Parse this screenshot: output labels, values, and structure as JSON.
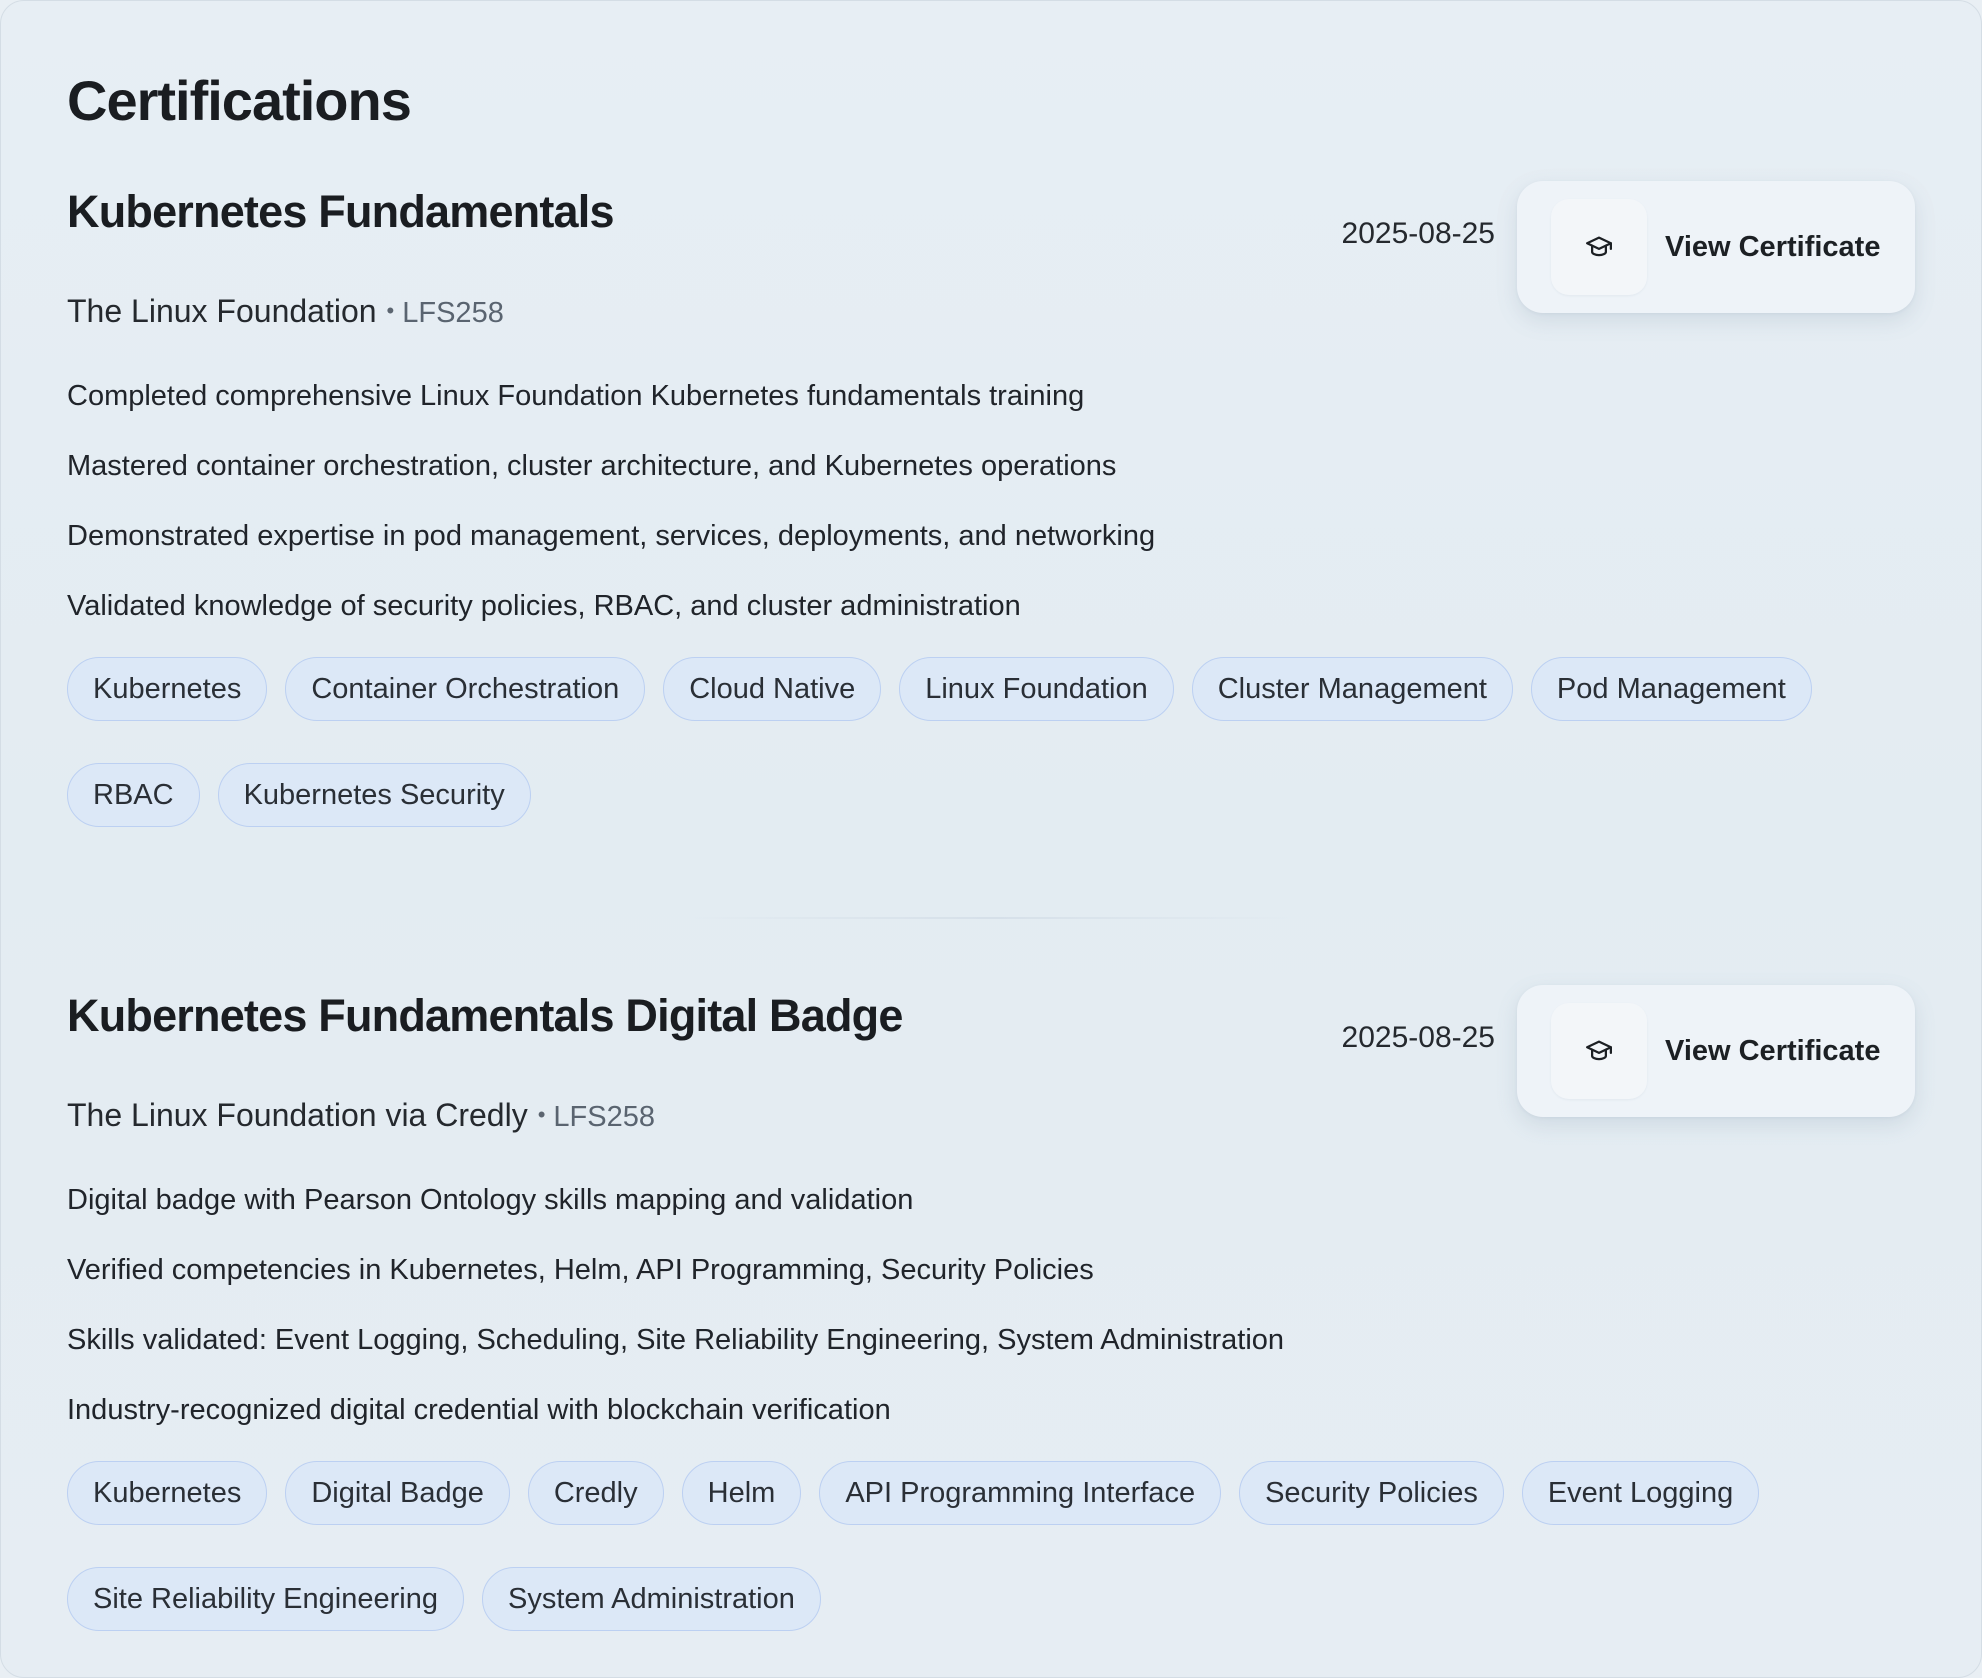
{
  "section": {
    "title": "Certifications"
  },
  "certifications": [
    {
      "title": "Kubernetes Fundamentals",
      "date": "2025-08-25",
      "button_label": "View Certificate",
      "button_icon": "graduation-cap-icon",
      "issuer": "The Linux Foundation",
      "separator": "•",
      "code": "LFS258",
      "bullets": [
        "Completed comprehensive Linux Foundation Kubernetes fundamentals training",
        "Mastered container orchestration, cluster architecture, and Kubernetes operations",
        "Demonstrated expertise in pod management, services, deployments, and networking",
        "Validated knowledge of security policies, RBAC, and cluster administration"
      ],
      "tags": [
        "Kubernetes",
        "Container Orchestration",
        "Cloud Native",
        "Linux Foundation",
        "Cluster Management",
        "Pod Management",
        "RBAC",
        "Kubernetes Security"
      ]
    },
    {
      "title": "Kubernetes Fundamentals Digital Badge",
      "date": "2025-08-25",
      "button_label": "View Certificate",
      "button_icon": "graduation-cap-icon",
      "issuer": "The Linux Foundation via Credly",
      "separator": "•",
      "code": "LFS258",
      "bullets": [
        "Digital badge with Pearson Ontology skills mapping and validation",
        "Verified competencies in Kubernetes, Helm, API Programming, Security Policies",
        "Skills validated: Event Logging, Scheduling, Site Reliability Engineering, System Administration",
        "Industry-recognized digital credential with blockchain verification"
      ],
      "tags": [
        "Kubernetes",
        "Digital Badge",
        "Credly",
        "Helm",
        "API Programming Interface",
        "Security Policies",
        "Event Logging",
        "Site Reliability Engineering",
        "System Administration"
      ]
    }
  ],
  "colors": {
    "background": "#e7eef4",
    "tag_background": "#dce8f7",
    "tag_border": "#bcd0f2",
    "text_primary": "#1a1d21",
    "text_secondary": "#5a6470",
    "button_background": "#eef3f8"
  }
}
